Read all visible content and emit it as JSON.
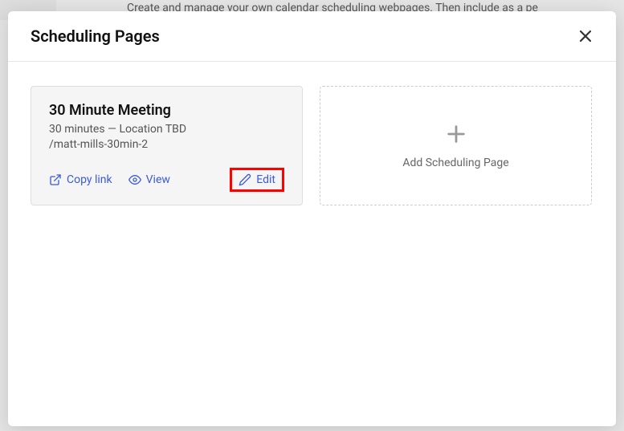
{
  "backdrop": {
    "text": "Create and manage your own calendar scheduling webpages. Then include as a pe"
  },
  "modal": {
    "title": "Scheduling Pages"
  },
  "card": {
    "title": "30 Minute Meeting",
    "subtitle": "30 minutes — Location TBD",
    "slug": "/matt-mills-30min-2",
    "actions": {
      "copy": "Copy link",
      "view": "View",
      "edit": "Edit"
    }
  },
  "addCard": {
    "label": "Add Scheduling Page"
  }
}
